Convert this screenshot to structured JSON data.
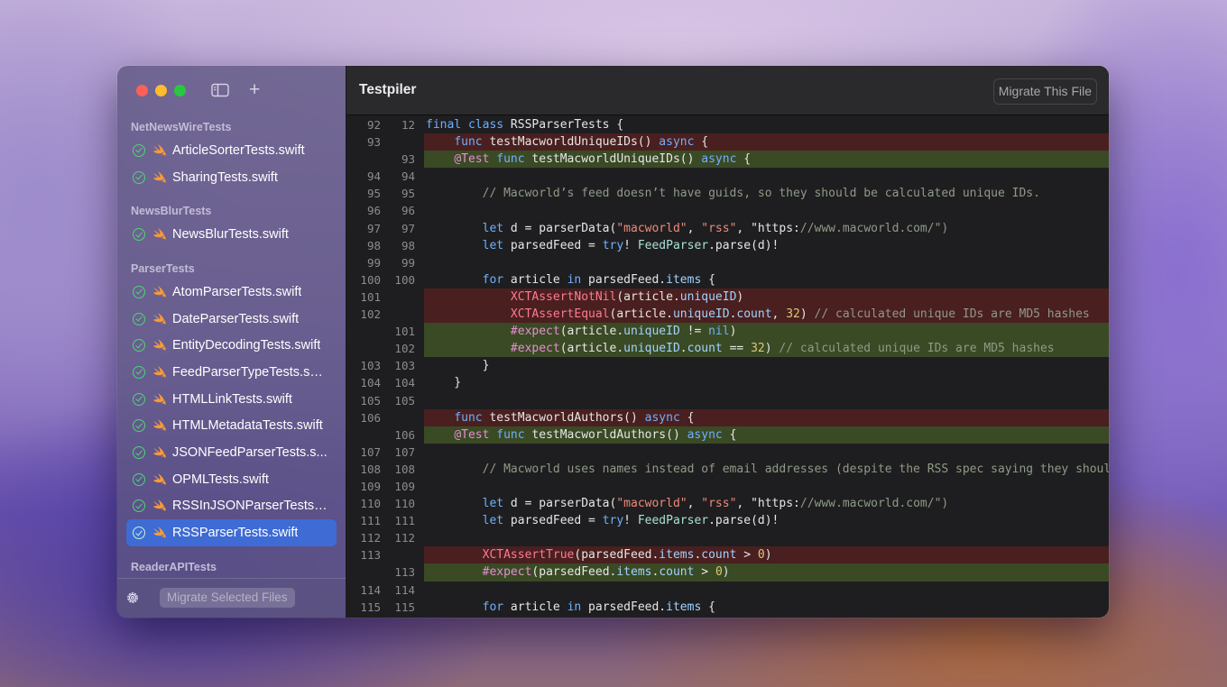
{
  "window": {
    "title": "Testpiler",
    "migrate_file_label": "Migrate This File",
    "migrate_selected_label": "Migrate Selected Files"
  },
  "sidebar": {
    "groups": [
      {
        "name": "NetNewsWireTests",
        "items": [
          "ArticleSorterTests.swift",
          "SharingTests.swift"
        ]
      },
      {
        "name": "NewsBlurTests",
        "items": [
          "NewsBlurTests.swift"
        ]
      },
      {
        "name": "ParserTests",
        "items": [
          "AtomParserTests.swift",
          "DateParserTests.swift",
          "EntityDecodingTests.swift",
          "FeedParserTypeTests.swift",
          "HTMLLinkTests.swift",
          "HTMLMetadataTests.swift",
          "JSONFeedParserTests.s...",
          "OPMLTests.swift",
          "RSSInJSONParserTests.s...",
          "RSSParserTests.swift"
        ]
      },
      {
        "name": "ReaderAPITests",
        "items": []
      }
    ],
    "selected_item": "RSSParserTests.swift"
  },
  "code_lines": [
    {
      "a": "92",
      "b": "12",
      "type": "ctx",
      "text": "final class RSSParserTests {"
    },
    {
      "a": "93",
      "b": "",
      "type": "del",
      "text": "    func testMacworldUniqueIDs() async {"
    },
    {
      "a": "",
      "b": "93",
      "type": "add",
      "text": "    @Test func testMacworldUniqueIDs() async {"
    },
    {
      "a": "94",
      "b": "94",
      "type": "ctx",
      "text": ""
    },
    {
      "a": "95",
      "b": "95",
      "type": "ctx",
      "text": "        // Macworld’s feed doesn’t have guids, so they should be calculated unique IDs."
    },
    {
      "a": "96",
      "b": "96",
      "type": "ctx",
      "text": ""
    },
    {
      "a": "97",
      "b": "97",
      "type": "ctx",
      "text": "        let d = parserData(\"macworld\", \"rss\", \"https://www.macworld.com/\")"
    },
    {
      "a": "98",
      "b": "98",
      "type": "ctx",
      "text": "        let parsedFeed = try! FeedParser.parse(d)!"
    },
    {
      "a": "99",
      "b": "99",
      "type": "ctx",
      "text": ""
    },
    {
      "a": "100",
      "b": "100",
      "type": "ctx",
      "text": "        for article in parsedFeed.items {"
    },
    {
      "a": "101",
      "b": "",
      "type": "del",
      "text": "            XCTAssertNotNil(article.uniqueID)"
    },
    {
      "a": "102",
      "b": "",
      "type": "del",
      "text": "            XCTAssertEqual(article.uniqueID.count, 32) // calculated unique IDs are MD5 hashes"
    },
    {
      "a": "",
      "b": "101",
      "type": "add",
      "text": "            #expect(article.uniqueID != nil)"
    },
    {
      "a": "",
      "b": "102",
      "type": "add",
      "text": "            #expect(article.uniqueID.count == 32) // calculated unique IDs are MD5 hashes"
    },
    {
      "a": "103",
      "b": "103",
      "type": "ctx",
      "text": "        }"
    },
    {
      "a": "104",
      "b": "104",
      "type": "ctx",
      "text": "    }"
    },
    {
      "a": "105",
      "b": "105",
      "type": "ctx",
      "text": ""
    },
    {
      "a": "106",
      "b": "",
      "type": "del",
      "text": "    func testMacworldAuthors() async {"
    },
    {
      "a": "",
      "b": "106",
      "type": "add",
      "text": "    @Test func testMacworldAuthors() async {"
    },
    {
      "a": "107",
      "b": "107",
      "type": "ctx",
      "text": ""
    },
    {
      "a": "108",
      "b": "108",
      "type": "ctx",
      "text": "        // Macworld uses names instead of email addresses (despite the RSS spec saying they should"
    },
    {
      "a": "109",
      "b": "109",
      "type": "ctx",
      "text": ""
    },
    {
      "a": "110",
      "b": "110",
      "type": "ctx",
      "text": "        let d = parserData(\"macworld\", \"rss\", \"https://www.macworld.com/\")"
    },
    {
      "a": "111",
      "b": "111",
      "type": "ctx",
      "text": "        let parsedFeed = try! FeedParser.parse(d)!"
    },
    {
      "a": "112",
      "b": "112",
      "type": "ctx",
      "text": ""
    },
    {
      "a": "113",
      "b": "",
      "type": "del",
      "text": "        XCTAssertTrue(parsedFeed.items.count > 0)"
    },
    {
      "a": "",
      "b": "113",
      "type": "add",
      "text": "        #expect(parsedFeed.items.count > 0)"
    },
    {
      "a": "114",
      "b": "114",
      "type": "ctx",
      "text": ""
    },
    {
      "a": "115",
      "b": "115",
      "type": "ctx",
      "text": "        for article in parsedFeed.items {"
    }
  ],
  "colors": {
    "selection": "#3e6bd4",
    "deleted_line": "#4a1f1f",
    "added_line": "#3a4a24",
    "check": "#4fd474",
    "swift_icon": "#f59a3b"
  },
  "icons": {
    "sidebar_toggle": "sidebar-toggle-icon",
    "add": "plus-icon",
    "file": "swift-icon",
    "status": "checkmark-circle-icon",
    "settings": "gear-icon"
  }
}
